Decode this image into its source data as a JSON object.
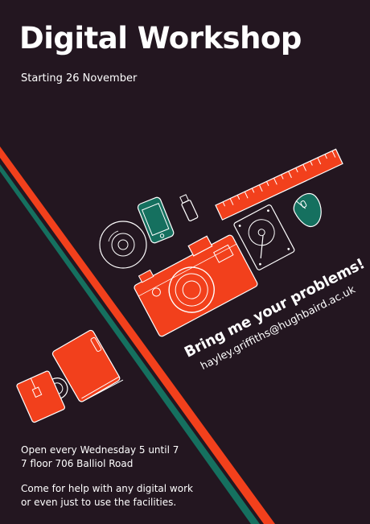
{
  "poster": {
    "title": "Digital Workshop",
    "subtitle": "Starting 26 November",
    "tagline": "Bring me your problems!",
    "email": "hayley.griffiths@hughbaird.ac.uk",
    "info_lines": [
      "Open every Wednesday 5 until 7",
      "7 floor 706 Balliol Road"
    ],
    "help_lines": [
      "Come for help with any digital work",
      "or even just to use the facilities."
    ]
  },
  "colors": {
    "background": "#231620",
    "accent_red": "#f2401c",
    "accent_teal": "#15705f",
    "outline": "#ffffff"
  },
  "icons": [
    "ruler-icon",
    "phone-icon",
    "usb-drive-icon",
    "mouse-icon",
    "cd-icon",
    "hard-drive-icon",
    "camera-icon",
    "mug-icon",
    "notebook-icon"
  ]
}
